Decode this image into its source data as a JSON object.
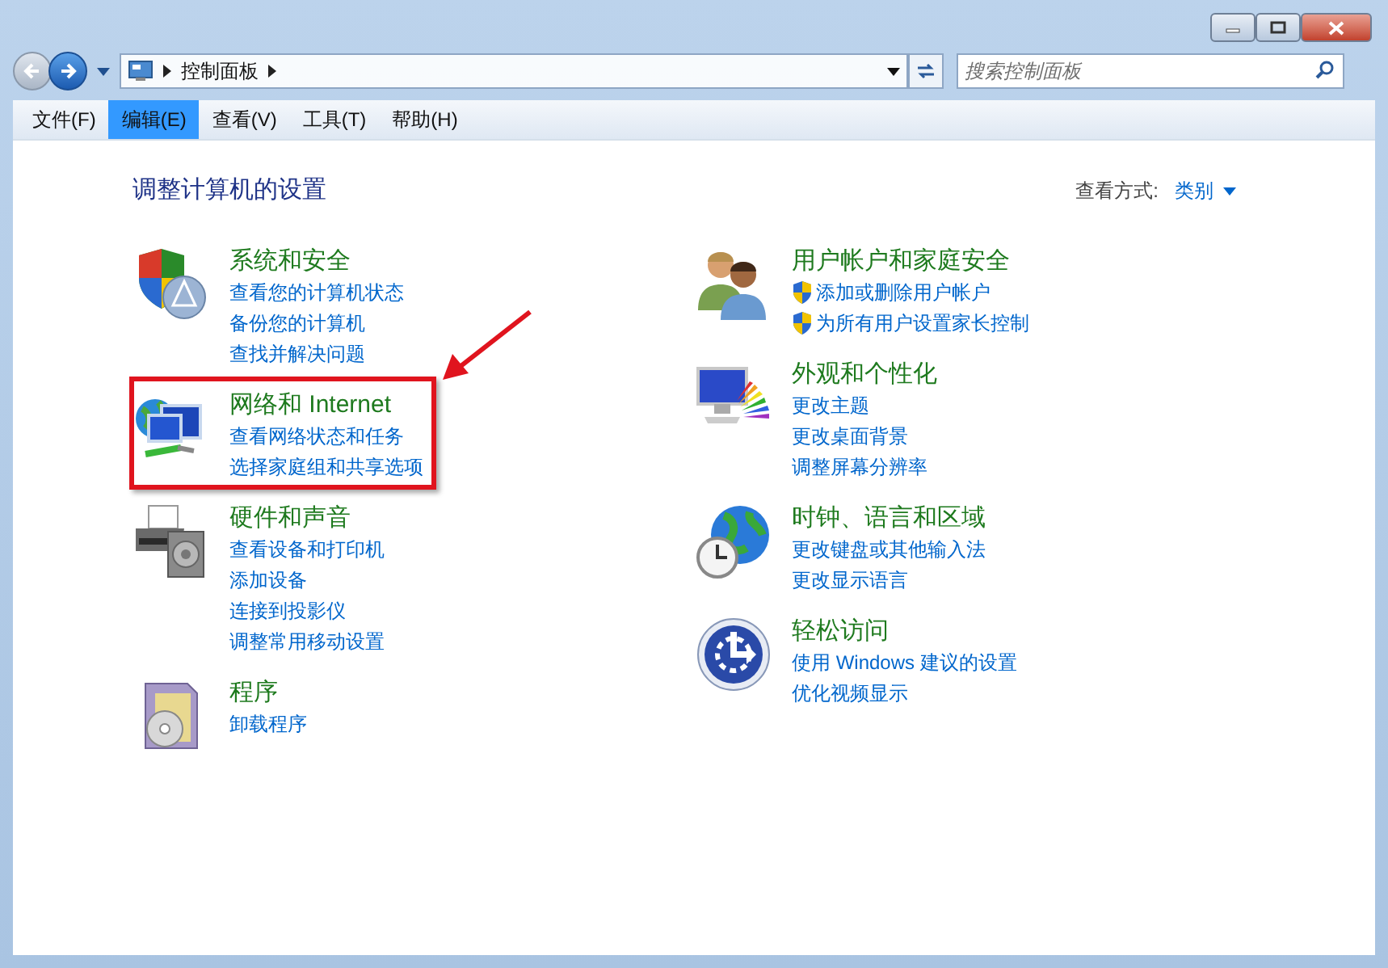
{
  "address_bar": {
    "path": [
      "控制面板"
    ]
  },
  "search": {
    "placeholder": "搜索控制面板"
  },
  "menu": [
    {
      "label": "文件(F)",
      "selected": false
    },
    {
      "label": "编辑(E)",
      "selected": true
    },
    {
      "label": "查看(V)",
      "selected": false
    },
    {
      "label": "工具(T)",
      "selected": false
    },
    {
      "label": "帮助(H)",
      "selected": false
    }
  ],
  "heading": "调整计算机的设置",
  "view_by": {
    "label": "查看方式:",
    "value": "类别"
  },
  "columns": [
    [
      {
        "title": "系统和安全",
        "highlighted": false,
        "links": [
          {
            "text": "查看您的计算机状态",
            "shield": false
          },
          {
            "text": "备份您的计算机",
            "shield": false
          },
          {
            "text": "查找并解决问题",
            "shield": false
          }
        ]
      },
      {
        "title": "网络和 Internet",
        "highlighted": true,
        "links": [
          {
            "text": "查看网络状态和任务",
            "shield": false
          },
          {
            "text": "选择家庭组和共享选项",
            "shield": false
          }
        ]
      },
      {
        "title": "硬件和声音",
        "highlighted": false,
        "links": [
          {
            "text": "查看设备和打印机",
            "shield": false
          },
          {
            "text": "添加设备",
            "shield": false
          },
          {
            "text": "连接到投影仪",
            "shield": false
          },
          {
            "text": "调整常用移动设置",
            "shield": false
          }
        ]
      },
      {
        "title": "程序",
        "highlighted": false,
        "links": [
          {
            "text": "卸载程序",
            "shield": false
          }
        ]
      }
    ],
    [
      {
        "title": "用户帐户和家庭安全",
        "highlighted": false,
        "links": [
          {
            "text": "添加或删除用户帐户",
            "shield": true
          },
          {
            "text": "为所有用户设置家长控制",
            "shield": true
          }
        ]
      },
      {
        "title": "外观和个性化",
        "highlighted": false,
        "links": [
          {
            "text": "更改主题",
            "shield": false
          },
          {
            "text": "更改桌面背景",
            "shield": false
          },
          {
            "text": "调整屏幕分辨率",
            "shield": false
          }
        ]
      },
      {
        "title": "时钟、语言和区域",
        "highlighted": false,
        "links": [
          {
            "text": "更改键盘或其他输入法",
            "shield": false
          },
          {
            "text": "更改显示语言",
            "shield": false
          }
        ]
      },
      {
        "title": "轻松访问",
        "highlighted": false,
        "links": [
          {
            "text": "使用 Windows 建议的设置",
            "shield": false
          },
          {
            "text": "优化视频显示",
            "shield": false
          }
        ]
      }
    ]
  ]
}
